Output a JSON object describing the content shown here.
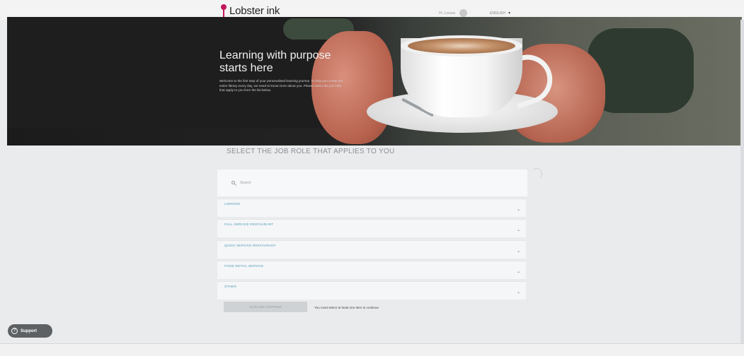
{
  "header": {
    "logo_text": "Lobster ink",
    "user_name": "Hi, Lorena",
    "language": "ENGLISH",
    "language_caret": "▾"
  },
  "hero": {
    "title": "Learning with purpose starts here",
    "body": "Welcome to the first step of your personalised learning journey. To help you create the entire library every day, we need to know more about you. Please select the job roles that apply to you from the list below."
  },
  "main": {
    "section_title": "SELECT THE JOB ROLE THAT APPLIES TO YOU",
    "search": {
      "placeholder": "Search"
    },
    "roles": [
      {
        "label": "LODGING"
      },
      {
        "label": "FULL SERVICE RESTAURANT"
      },
      {
        "label": "QUICK SERVICE RESTAURANT"
      },
      {
        "label": "FOOD RETAIL SERVICE"
      },
      {
        "label": "OTHER"
      }
    ],
    "chevron": "⌄",
    "continue_label": "SAVE AND CONTINUE",
    "continue_hint": "You must select at least one item to continue"
  },
  "support": {
    "label": "Support",
    "icon_glyph": "?"
  },
  "colors": {
    "brand": "#c2185b",
    "role_text": "#4d9ab6",
    "support_bg": "#5d6163"
  }
}
